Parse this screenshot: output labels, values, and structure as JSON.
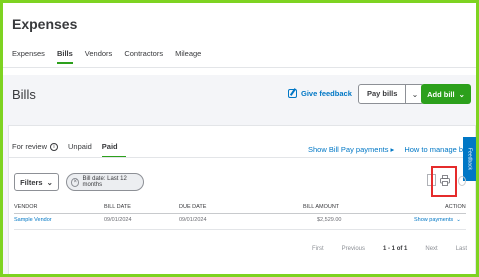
{
  "app": {
    "title": "Expenses"
  },
  "top_tabs": [
    {
      "label": "Expenses",
      "active": false
    },
    {
      "label": "Bills",
      "active": true
    },
    {
      "label": "Vendors",
      "active": false
    },
    {
      "label": "Contractors",
      "active": false
    },
    {
      "label": "Mileage",
      "active": false
    }
  ],
  "bills_header": {
    "title": "Bills",
    "feedback_label": "Give feedback",
    "pay_bills_label": "Pay bills",
    "add_bill_label": "Add bill"
  },
  "sub_tabs": [
    {
      "label": "For review",
      "active": false
    },
    {
      "label": "Unpaid",
      "active": false
    },
    {
      "label": "Paid",
      "active": true
    }
  ],
  "links": {
    "bill_pay": "Show Bill Pay payments ▸",
    "manage_bills": "How to manage bills ▸"
  },
  "feedback_tab": "Feedback",
  "filters": {
    "button_label": "Filters",
    "chip_label": "Bill date: Last 12 months"
  },
  "table": {
    "columns": [
      "VENDOR",
      "BILL DATE",
      "DUE DATE",
      "BILL AMOUNT",
      "ACTION"
    ],
    "rows": [
      {
        "vendor": "Sample Vendor",
        "bill_date": "09/01/2024",
        "due_date": "09/01/2024",
        "bill_amount": "$2,529.00",
        "action": "Show payments"
      }
    ]
  },
  "pagination": {
    "first": "First",
    "previous": "Previous",
    "current": "1 - 1 of 1",
    "next": "Next",
    "last": "Last"
  },
  "colors": {
    "accent_green": "#2ca01c",
    "link_blue": "#0077c5",
    "highlight_red": "#e52b2b",
    "frame_green": "#7ed321"
  }
}
